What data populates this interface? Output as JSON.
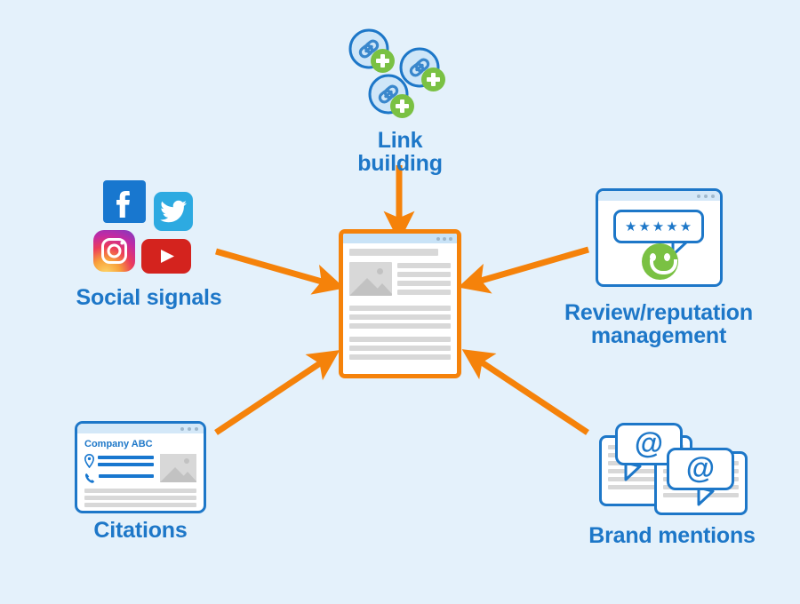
{
  "diagram": {
    "title": "Local SEO ranking signals diagram",
    "background_color": "#e4f1fb",
    "accent_blue": "#1d77c8",
    "accent_orange": "#f5820a",
    "accent_green": "#7ac143"
  },
  "center": {
    "name": "website-page",
    "titlebar_dots": 3
  },
  "nodes": {
    "link_building": {
      "label": "Link building",
      "icon": "link-plus-icon",
      "count": 3
    },
    "social_signals": {
      "label": "Social signals",
      "icons": [
        {
          "name": "facebook-icon",
          "glyph": "f",
          "color": "#1877cf"
        },
        {
          "name": "twitter-icon",
          "glyph": "bird",
          "color": "#2daae1"
        },
        {
          "name": "instagram-icon",
          "glyph": "camera",
          "color": "#d6249f"
        },
        {
          "name": "youtube-icon",
          "glyph": "play",
          "color": "#d4231e"
        }
      ]
    },
    "review_reputation": {
      "label": "Review/reputation\nmanagement",
      "icon": "review-window-icon",
      "stars": "★ ★ ★ ★ ★",
      "star_count": 5,
      "smiley": "smiley-face-icon"
    },
    "citations": {
      "label": "Citations",
      "icon": "citation-window-icon",
      "company_name": "Company ABC",
      "fields": [
        {
          "name": "location-pin-icon",
          "glyph": "📍"
        },
        {
          "name": "phone-icon",
          "glyph": "📞"
        }
      ]
    },
    "brand_mentions": {
      "label": "Brand mentions",
      "icon": "mention-bubble-icon",
      "symbol": "@",
      "bubble_count": 2
    }
  },
  "arrows": [
    {
      "name": "arrow-link-building-to-page",
      "from": "link_building",
      "to": "center"
    },
    {
      "name": "arrow-social-signals-to-page",
      "from": "social_signals",
      "to": "center"
    },
    {
      "name": "arrow-review-to-page",
      "from": "review_reputation",
      "to": "center"
    },
    {
      "name": "arrow-citations-to-page",
      "from": "citations",
      "to": "center"
    },
    {
      "name": "arrow-brand-mentions-to-page",
      "from": "brand_mentions",
      "to": "center"
    }
  ]
}
